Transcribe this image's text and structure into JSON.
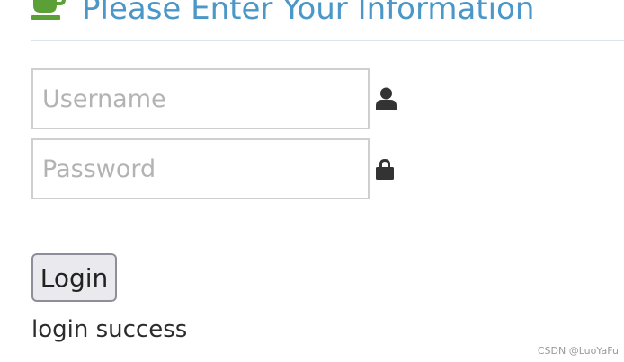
{
  "header": {
    "title": "Please Enter Your Information",
    "icon": "coffee-cup-icon",
    "accent_color": "#4a97c8",
    "icon_color": "#5aa036"
  },
  "form": {
    "username": {
      "placeholder": "Username",
      "value": "",
      "icon": "user-icon"
    },
    "password": {
      "placeholder": "Password",
      "value": "",
      "icon": "lock-icon"
    },
    "login_label": "Login"
  },
  "status": {
    "message": "login success"
  },
  "watermark": {
    "text": "CSDN @LuoYaFu"
  }
}
